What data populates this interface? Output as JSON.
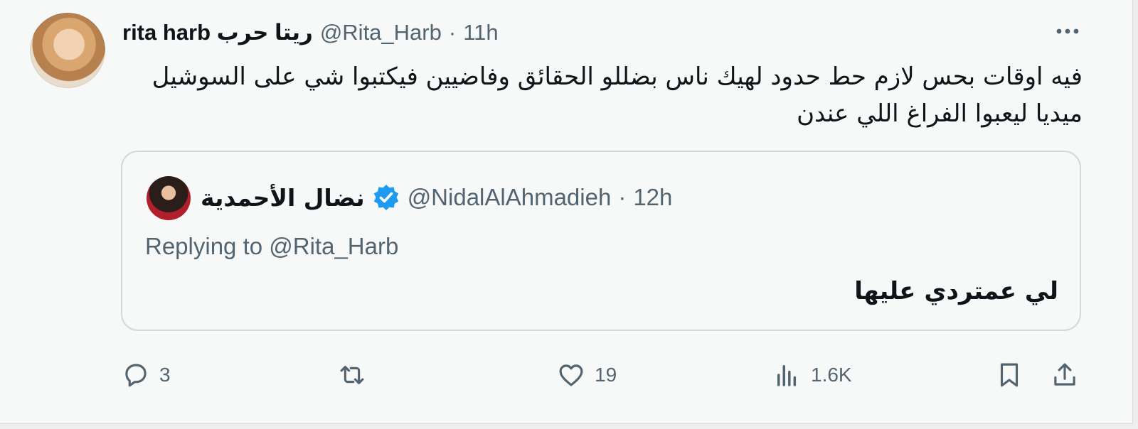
{
  "tweet": {
    "author_name": "rita harb ريتا حرب",
    "handle": "@Rita_Harb",
    "separator": "·",
    "time": "11h",
    "text": "فيه اوقات بحس لازم حط حدود لهيك ناس بضللو الحقائق وفاضيين فيكتبوا شي على السوشيل ميديا ليعبوا الفراغ اللي عندن"
  },
  "quoted": {
    "author_name": "نضال الأحمدية",
    "verified": true,
    "handle": "@NidalAlAhmadieh",
    "separator": "·",
    "time": "12h",
    "replying_to": "Replying to @Rita_Harb",
    "text": "لي عمتردي عليها"
  },
  "actions": {
    "replies": "3",
    "retweets": "",
    "likes": "19",
    "views": "1.6K"
  },
  "colors": {
    "background": "#f7f9f9",
    "text": "#0f1419",
    "muted": "#536471",
    "border": "#cfd9de",
    "verified": "#1d9bf0"
  },
  "icons": {
    "more": "more-horizontal-icon",
    "verified": "verified-badge-icon",
    "reply": "reply-icon",
    "retweet": "retweet-icon",
    "like": "heart-icon",
    "views": "views-chart-icon",
    "bookmark": "bookmark-icon",
    "share": "share-icon"
  }
}
